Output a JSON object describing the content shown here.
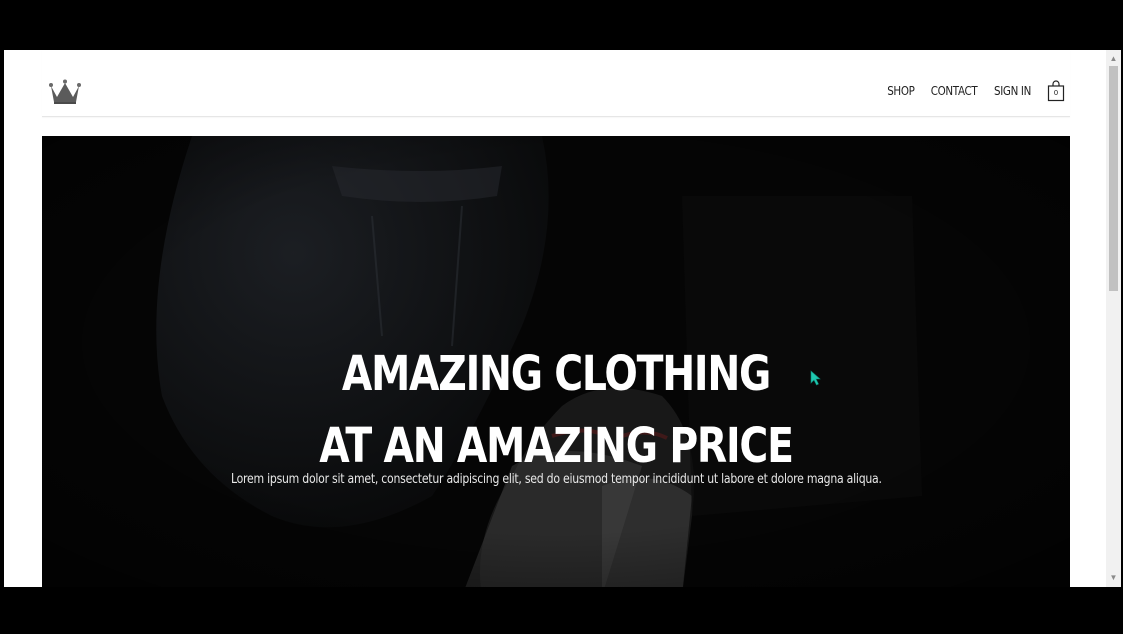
{
  "header": {
    "logo_icon": "crown-icon",
    "nav": [
      {
        "label": "SHOP"
      },
      {
        "label": "CONTACT"
      },
      {
        "label": "SIGN IN"
      }
    ],
    "cart": {
      "icon": "shopping-bag-icon",
      "count": "0"
    }
  },
  "hero": {
    "title_line1": "AMAZING CLOTHING",
    "title_line2": "AT AN AMAZING PRICE",
    "subtitle": "Lorem ipsum dolor sit amet, consectetur adipiscing elit, sed do eiusmod tempor incididunt ut labore et dolore magna aliqua."
  },
  "colors": {
    "hero_bg": "#050505",
    "cursor": "#1fc8b0",
    "logo": "#5a5a5a"
  }
}
